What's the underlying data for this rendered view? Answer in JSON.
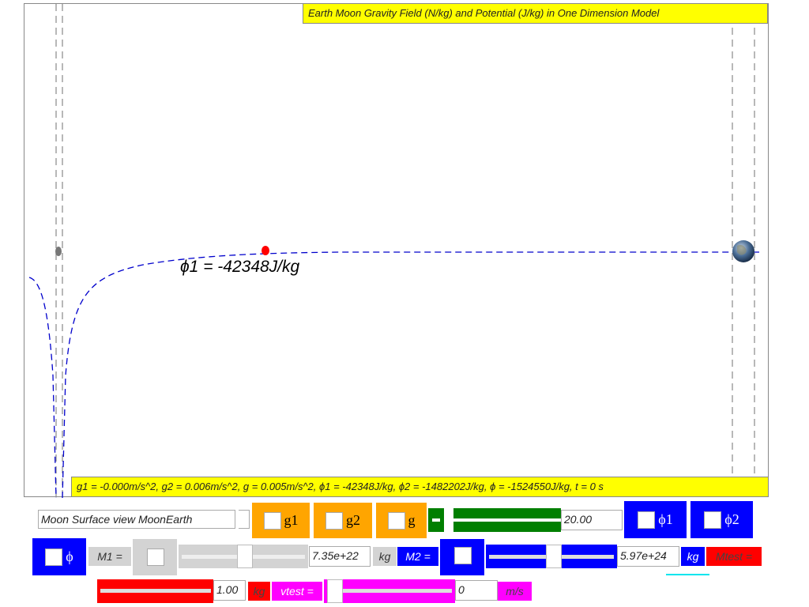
{
  "title": "Earth Moon Gravity Field (N/kg) and Potential (J/kg) in One Dimension Model",
  "status": "g1 = -0.000m/s^2, g2 = 0.006m/s^2, g = 0.005m/s^2, ϕ1 = -42348J/kg, ϕ2 = -1482202J/kg, ϕ = -1524550J/kg, t = 0 s",
  "probe_label": "ϕ1 = -42348J/kg",
  "view_select": "Moon Surface view MoonEarth",
  "buttons": {
    "g1": "g1",
    "g2": "g2",
    "g": "g",
    "phi1": "ϕ1",
    "phi2": "ϕ2",
    "phi": "ϕ"
  },
  "scale_value": "20.00",
  "m1": {
    "label": "M1 =",
    "value": "7.35e+22",
    "unit": "kg"
  },
  "m2": {
    "label": "M2 =",
    "value": "5.97e+24",
    "unit": "kg"
  },
  "mtest": {
    "label": "Mtest =",
    "value": "1.00",
    "unit": "kg"
  },
  "vtest": {
    "label": "vtest =",
    "value": "0",
    "unit": "m/s"
  },
  "colors": {
    "orange": "#ffa500",
    "green": "#007f00",
    "blue": "#0000ff",
    "red": "#ff0000",
    "magenta": "#ff00ff",
    "yellow": "#ffff00",
    "grey": "#d3d3d3"
  }
}
